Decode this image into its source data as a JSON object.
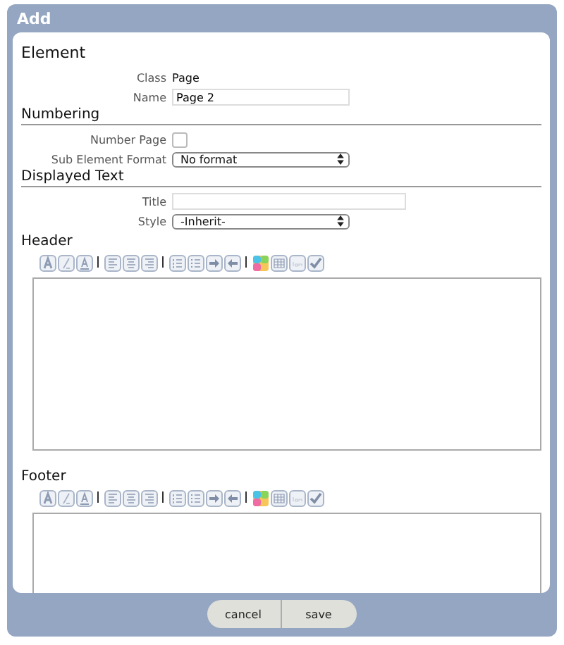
{
  "dialog": {
    "title": "Add"
  },
  "sections": [
    {
      "heading": "Element",
      "fields": [
        {
          "kind": "static",
          "label": "Class",
          "value": "Page"
        },
        {
          "kind": "text",
          "label": "Name",
          "value": "Page 2"
        }
      ]
    },
    {
      "heading": "Numbering",
      "fields": [
        {
          "kind": "checkbox",
          "label": "Number Page",
          "checked": false
        },
        {
          "kind": "select",
          "label": "Sub Element Format",
          "value": "No format"
        }
      ]
    },
    {
      "heading": "Displayed Text",
      "fields": [
        {
          "kind": "text",
          "label": "Title"
        },
        {
          "kind": "select",
          "label": "Style",
          "value": "-Inherit-"
        }
      ]
    }
  ],
  "editors": [
    {
      "label": "Header"
    },
    {
      "label": "Footer"
    }
  ],
  "buttons": [
    {
      "label": "cancel"
    },
    {
      "label": "save"
    }
  ]
}
